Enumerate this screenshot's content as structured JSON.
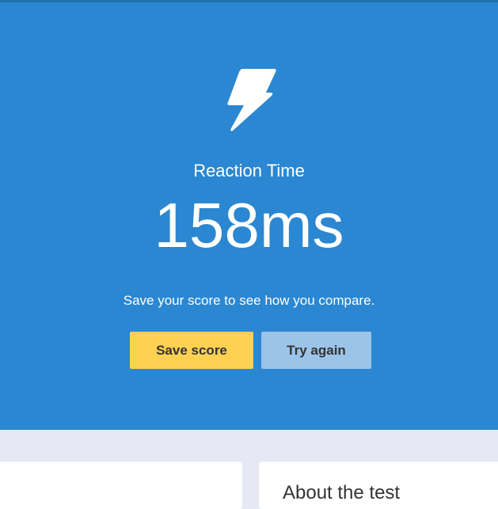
{
  "hero": {
    "icon": "lightning-bolt-icon",
    "title": "Reaction Time",
    "result": "158ms",
    "subtitle": "Save your score to see how you compare.",
    "save_label": "Save score",
    "retry_label": "Try again"
  },
  "about": {
    "heading": "About the test"
  },
  "colors": {
    "hero_background": "#2b87d1",
    "save_button": "#ffd152",
    "retry_button": "#9cc4e8",
    "page_background": "#e6e8f4"
  }
}
